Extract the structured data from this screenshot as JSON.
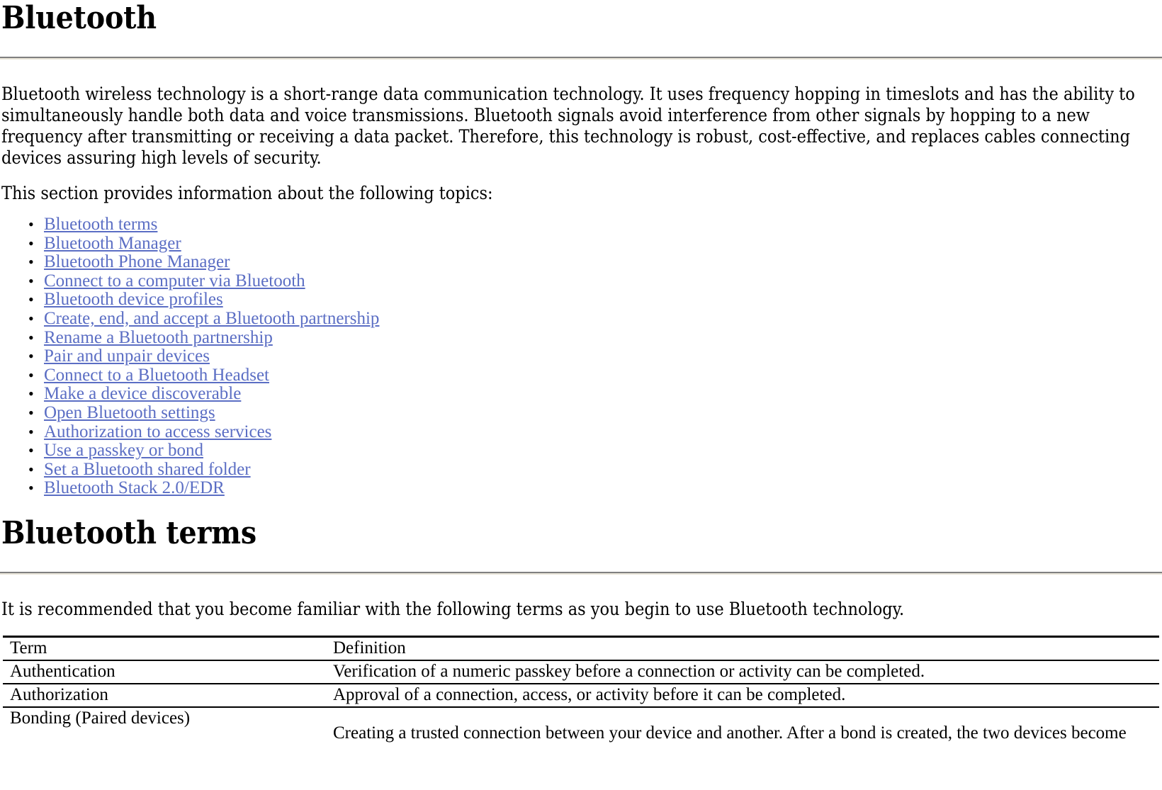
{
  "document": {
    "title": "Bluetooth",
    "sections": [
      {
        "heading": "Bluetooth",
        "paragraphs": [
          "Bluetooth wireless technology is a short-range data communication technology. It uses frequency hopping in timeslots and has the ability to simultaneously handle both data and voice transmissions. Bluetooth signals avoid interference from other signals by hopping to a new frequency after transmitting or receiving a data packet. Therefore, this technology is robust, cost-effective, and replaces cables connecting devices assuring high levels of security.",
          "This section provides information about the following topics:"
        ]
      },
      {
        "heading": "Bluetooth terms",
        "paragraphs": [
          "It is recommended that you become familiar with the following terms as you begin to use Bluetooth technology."
        ]
      }
    ],
    "topic_links": [
      {
        "label": "Bluetooth terms"
      },
      {
        "label": "Bluetooth Manager"
      },
      {
        "label": "Bluetooth Phone Manager"
      },
      {
        "label": "Connect to a computer via Bluetooth"
      },
      {
        "label": "Bluetooth device profiles"
      },
      {
        "label": "Create, end, and accept a Bluetooth partnership"
      },
      {
        "label": "Rename a Bluetooth partnership"
      },
      {
        "label": "Pair and unpair devices"
      },
      {
        "label": "Connect to a Bluetooth Headset"
      },
      {
        "label": "Make a device discoverable"
      },
      {
        "label": "Open Bluetooth settings"
      },
      {
        "label": "Authorization to access services"
      },
      {
        "label": "Use a passkey or bond"
      },
      {
        "label": "Set a Bluetooth shared folder"
      },
      {
        "label": "Bluetooth Stack 2.0/EDR"
      }
    ],
    "terms_table": {
      "columns": [
        "Term",
        "Definition"
      ],
      "rows": [
        {
          "term": "Authentication",
          "definition": "Verification of a numeric passkey before a connection or activity can be completed."
        },
        {
          "term": "Authorization",
          "definition": "Approval of a connection, access, or activity before it can be completed."
        },
        {
          "term": "Bonding (Paired devices)",
          "definition": "Creating a trusted connection between your device and another. After a bond is created, the two devices become"
        }
      ]
    },
    "colors": {
      "link": "#5b6ec4",
      "text": "#000000",
      "rule_top": "#808080",
      "rule_bottom": "#e8e4d8",
      "table_border": "#000000",
      "background": "#ffffff"
    }
  }
}
